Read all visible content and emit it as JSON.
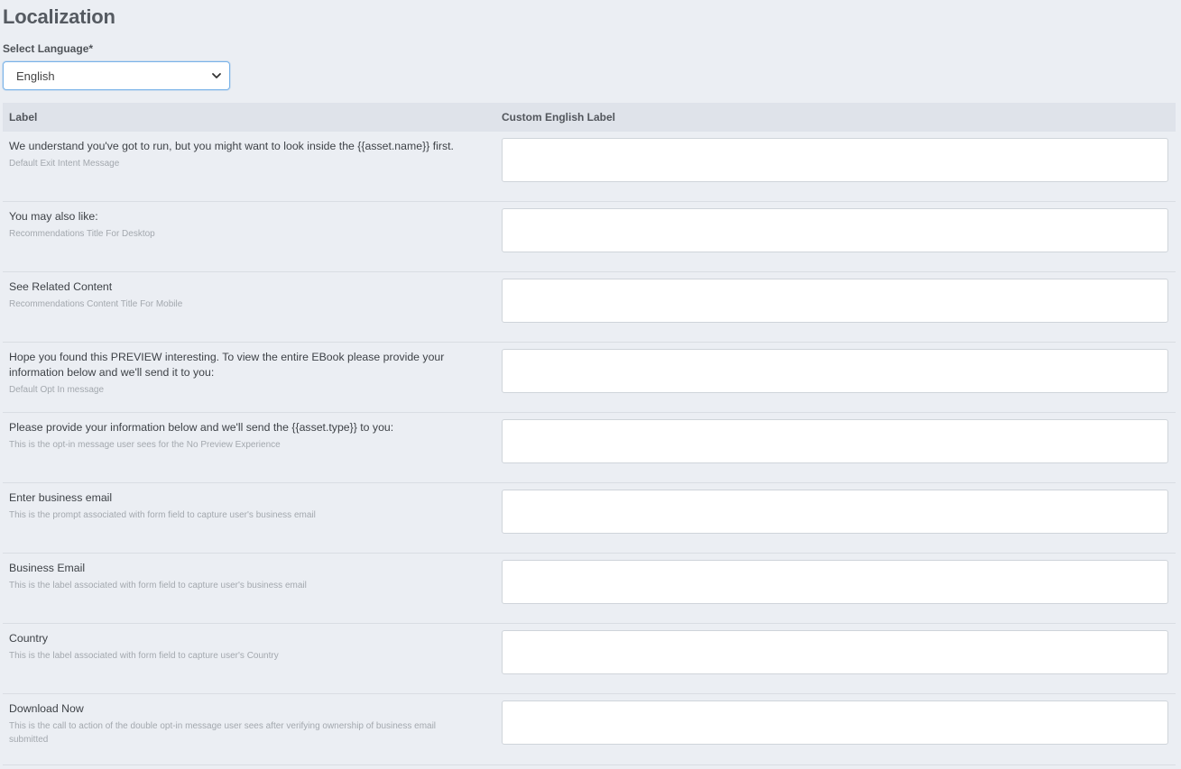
{
  "page": {
    "title": "Localization",
    "language_label": "Select Language*",
    "language_value": "English"
  },
  "table": {
    "headers": {
      "label": "Label",
      "custom": "Custom English Label"
    },
    "rows": [
      {
        "main": "We understand you've got to run, but you might want to look inside the {{asset.name}} first.",
        "sub": "Default Exit Intent Message",
        "value": ""
      },
      {
        "main": "You may also like:",
        "sub": "Recommendations Title For Desktop",
        "value": ""
      },
      {
        "main": "See Related Content",
        "sub": "Recommendations Content Title For Mobile",
        "value": ""
      },
      {
        "main": "Hope you found this PREVIEW interesting. To view the entire EBook please provide your information below and we'll send it to you:",
        "sub": "Default Opt In message",
        "value": ""
      },
      {
        "main": "Please provide your information below and we'll send the {{asset.type}} to you:",
        "sub": "This is the opt-in message user sees for the No Preview Experience",
        "value": ""
      },
      {
        "main": "Enter business email",
        "sub": "This is the prompt associated with form field to capture user's business email",
        "value": ""
      },
      {
        "main": "Business Email",
        "sub": "This is the label associated with form field to capture user's business email",
        "value": ""
      },
      {
        "main": "Country",
        "sub": "This is the label associated with form field to capture user's Country",
        "value": ""
      },
      {
        "main": "Download Now",
        "sub": "This is the call to action of the double opt-in message user sees after verifying ownership of business email submitted",
        "value": ""
      }
    ]
  }
}
